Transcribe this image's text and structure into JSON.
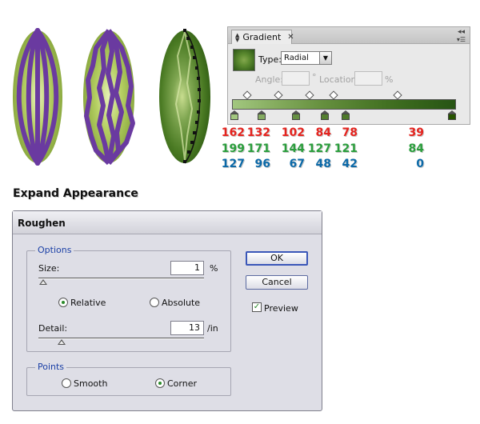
{
  "gradient_panel": {
    "tab_label": "Gradient",
    "type_label": "Type:",
    "type_value": "Radial",
    "angle_label": "Angle:",
    "degree_symbol": "°",
    "location_label": "Location:",
    "percent_symbol": "%"
  },
  "swatches": {
    "red": [
      "162",
      "132",
      "102",
      "84",
      "78",
      "39"
    ],
    "green": [
      "199",
      "171",
      "144",
      "127",
      "121",
      "84"
    ],
    "blue": [
      "127",
      "96",
      "67",
      "48",
      "42",
      "0"
    ]
  },
  "stop_colors": [
    "#a2c77f",
    "#84ab60",
    "#669043",
    "#547f30",
    "#4e792a",
    "#275400"
  ],
  "section_heading": "Expand Appearance",
  "roughen_dialog": {
    "title": "Roughen",
    "options_legend": "Options",
    "size_label": "Size:",
    "size_value": "1",
    "size_unit": "%",
    "relative_label": "Relative",
    "absolute_label": "Absolute",
    "detail_label": "Detail:",
    "detail_value": "13",
    "detail_unit": "/in",
    "points_legend": "Points",
    "smooth_label": "Smooth",
    "corner_label": "Corner",
    "ok_label": "OK",
    "cancel_label": "Cancel",
    "preview_label": "Preview",
    "relative_selected": true,
    "corner_selected": true,
    "preview_checked": true
  },
  "colors": {
    "red_text": "#e5231e",
    "green_text": "#2a9e3c",
    "blue_text": "#0b69a8",
    "stroke_purple": "#6a3aa0"
  }
}
